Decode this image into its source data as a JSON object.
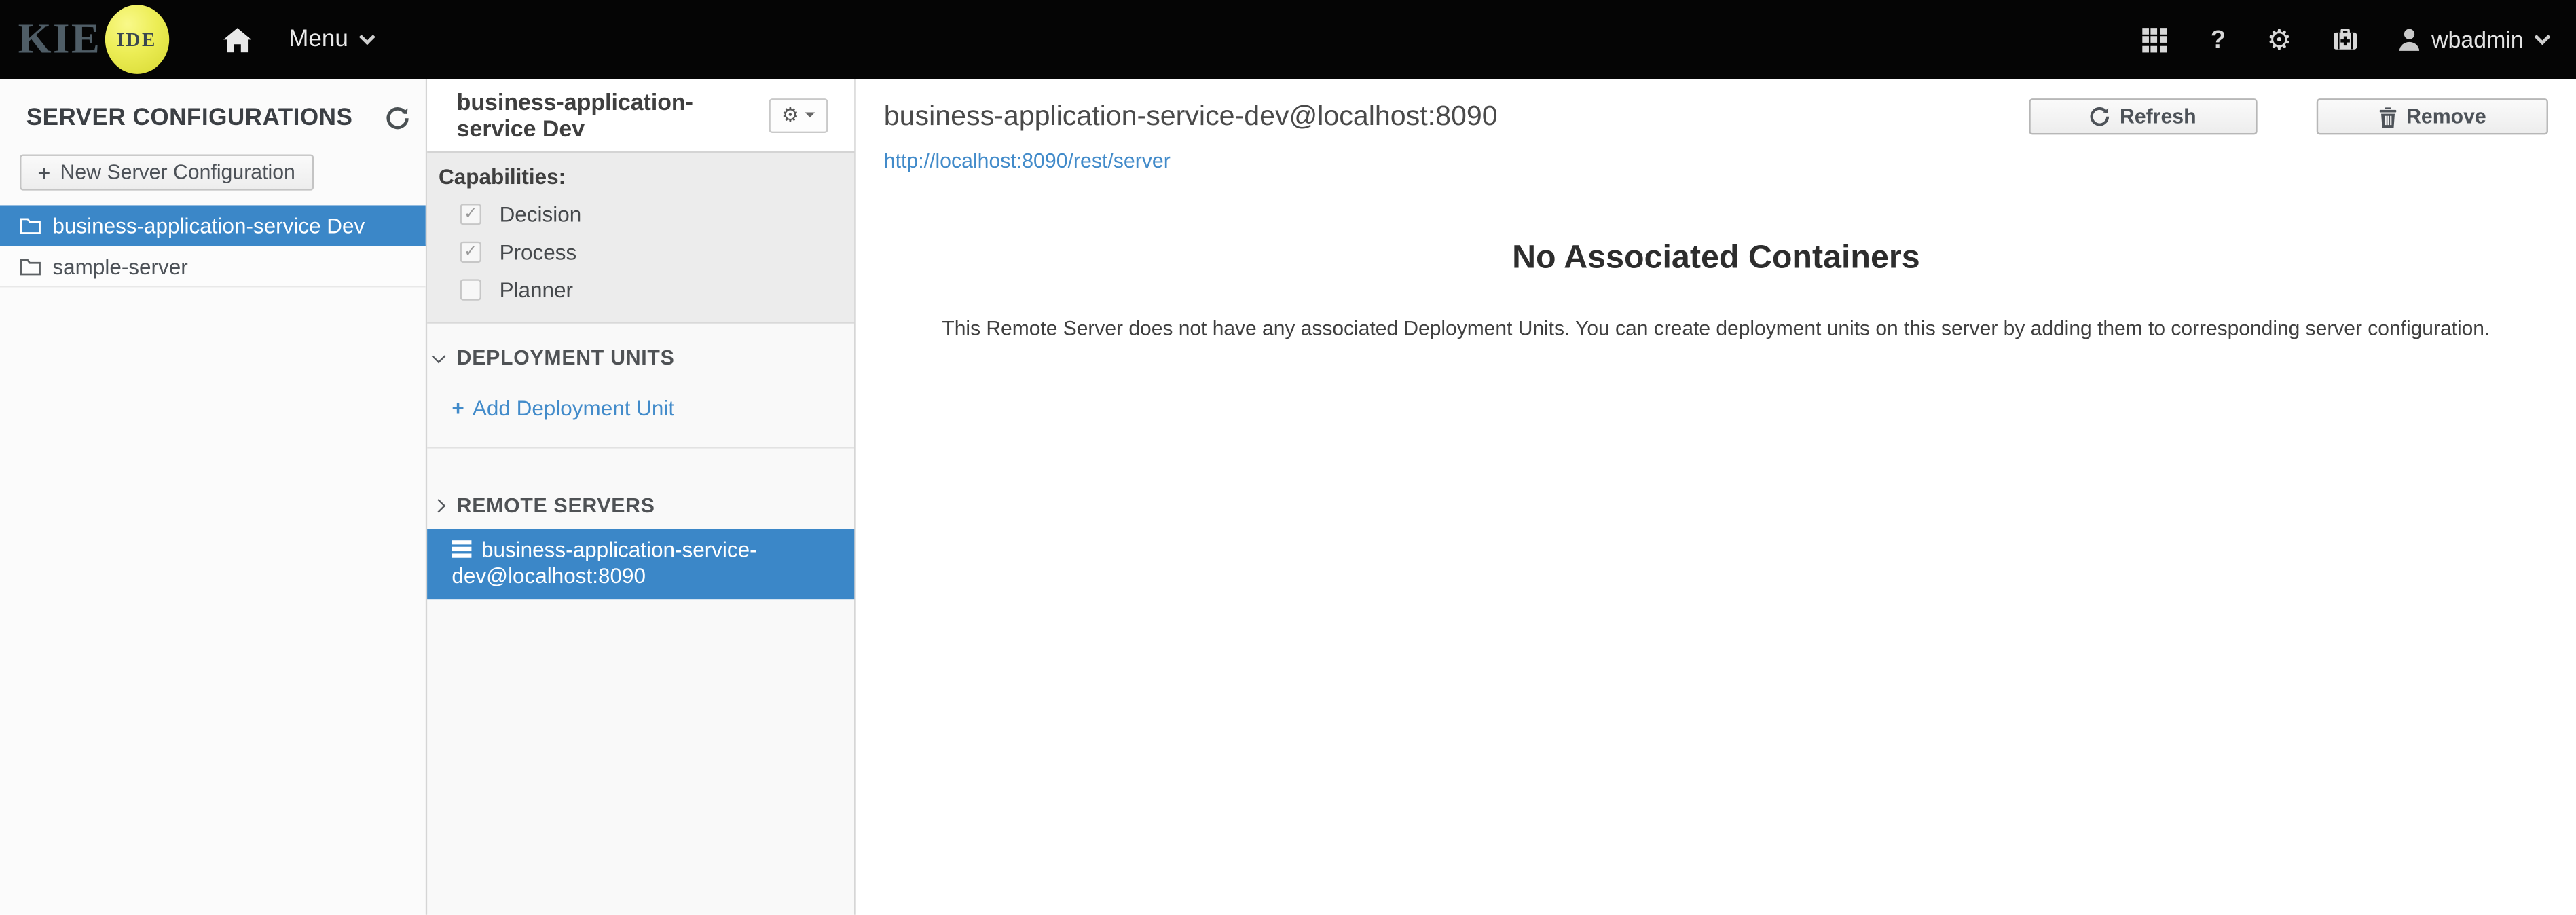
{
  "topbar": {
    "logo_text": "KIE",
    "logo_badge": "IDE",
    "menu_label": "Menu",
    "user_name": "wbadmin"
  },
  "glyphs": {
    "plus": "+",
    "question": "?",
    "gear": "⚙",
    "check": "✓"
  },
  "left_panel": {
    "title": "SERVER CONFIGURATIONS",
    "new_button_label": "New Server Configuration",
    "items": [
      {
        "label": "business-application-service Dev",
        "selected": true
      },
      {
        "label": "sample-server",
        "selected": false
      }
    ]
  },
  "config_panel": {
    "title": "business-application-service Dev",
    "capabilities_label": "Capabilities:",
    "capabilities": [
      {
        "label": "Decision",
        "checked": true
      },
      {
        "label": "Process",
        "checked": true
      },
      {
        "label": "Planner",
        "checked": false
      }
    ],
    "deployment_units_title": "DEPLOYMENT UNITS",
    "add_deployment_label": "Add Deployment Unit",
    "remote_servers_title": "REMOTE SERVERS",
    "remote_servers": [
      {
        "label": "business-application-service-dev@localhost:8090",
        "selected": true
      }
    ]
  },
  "main": {
    "title": "business-application-service-dev@localhost:8090",
    "url": "http://localhost:8090/rest/server",
    "refresh_label": "Refresh",
    "remove_label": "Remove",
    "empty_state": {
      "title": "No Associated Containers",
      "message": "This Remote Server does not have any associated Deployment Units. You can create deployment units on this server by adding them to corresponding server configuration."
    }
  },
  "colors": {
    "accent_blue": "#3b87c8",
    "link_blue": "#428bca",
    "topbar_black": "#050505",
    "logo_yellow": "#eced55",
    "capabilities_gray": "#ececec"
  }
}
